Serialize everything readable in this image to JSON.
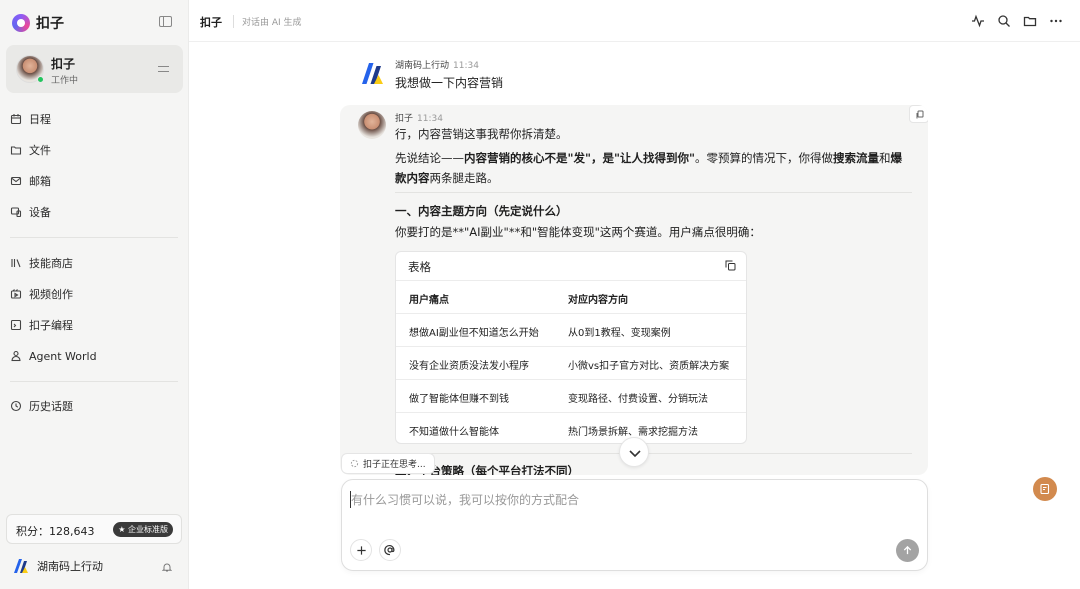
{
  "app": {
    "name": "扣子"
  },
  "profile": {
    "name": "扣子",
    "status": "工作中"
  },
  "sidebar": {
    "group1": [
      {
        "label": "日程",
        "icon": "calendar-icon"
      },
      {
        "label": "文件",
        "icon": "folder-icon"
      },
      {
        "label": "邮箱",
        "icon": "mail-icon"
      },
      {
        "label": "设备",
        "icon": "device-icon"
      }
    ],
    "group2": [
      {
        "label": "技能商店",
        "icon": "library-icon"
      },
      {
        "label": "视频创作",
        "icon": "video-icon"
      },
      {
        "label": "扣子编程",
        "icon": "code-icon"
      },
      {
        "label": "Agent World",
        "icon": "person-icon"
      }
    ],
    "group3": [
      {
        "label": "历史话题",
        "icon": "history-icon"
      }
    ],
    "points_label": "积分：128,643",
    "badge": "企业标准版",
    "team": "湖南码上行动"
  },
  "header": {
    "title": "扣子",
    "subtitle": "对话由 AI 生成"
  },
  "messages": {
    "user": {
      "name": "湖南码上行动",
      "time": "11:34",
      "text": "我想做一下内容营销"
    },
    "bot": {
      "name": "扣子",
      "time": "11:34",
      "line1": "行，内容营销这事我帮你拆清楚。",
      "p2a": "先说结论——",
      "p2b": "内容营销的核心不是\"发\"，是\"让人找得到你\"",
      "p2c": "。零预算的情况下，你得做",
      "p2d": "搜索流量",
      "p2e": "和",
      "p2f": "爆",
      "p2g": "款内容",
      "p2h": "两条腿走路。",
      "h1": "一、内容主题方向（先定说什么）",
      "p3": "你要打的是**\"AI副业\"**和\"智能体变现\"这两个赛道。用户痛点很明确：",
      "peek": "二、平台策略（每个平台打法不同）"
    }
  },
  "table": {
    "title": "表格",
    "headers": [
      "用户痛点",
      "对应内容方向"
    ],
    "rows": [
      [
        "想做AI副业但不知道怎么开始",
        "从0到1教程、变现案例"
      ],
      [
        "没有企业资质没法发小程序",
        "小微vs扣子官方对比、资质解决方案"
      ],
      [
        "做了智能体但赚不到钱",
        "变现路径、付费设置、分销玩法"
      ],
      [
        "不知道做什么智能体",
        "热门场景拆解、需求挖掘方法"
      ]
    ]
  },
  "thinking": "扣子正在思考...",
  "composer": {
    "placeholder": "有什么习惯可以说，我可以按你的方式配合"
  },
  "colors": {
    "accent": "#d28a4e",
    "sidebar_bg": "#f5f5f4",
    "online": "#22c55e"
  }
}
